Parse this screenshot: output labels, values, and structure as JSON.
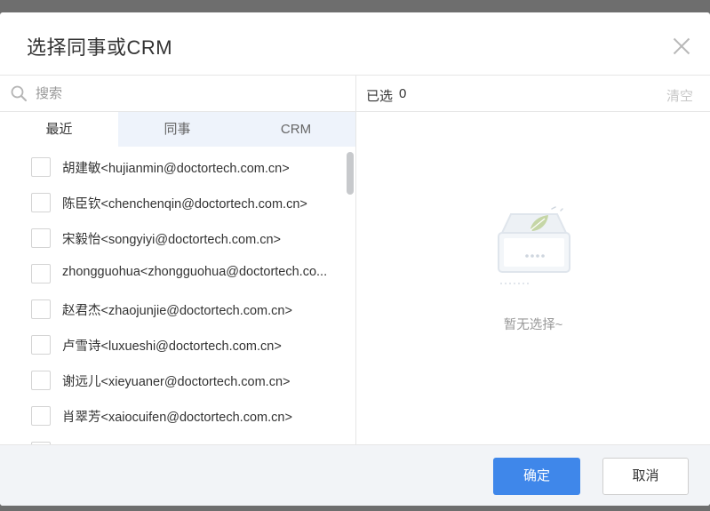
{
  "dialog": {
    "title": "选择同事或CRM",
    "close_icon": "close-icon"
  },
  "search": {
    "placeholder": "搜索",
    "value": "",
    "icon": "search-icon"
  },
  "tabs": [
    {
      "label": "最近",
      "active": true
    },
    {
      "label": "同事",
      "active": false
    },
    {
      "label": "CRM",
      "active": false
    }
  ],
  "contacts": [
    {
      "label": "胡建敏<hujianmin@doctortech.com.cn>",
      "checked": false
    },
    {
      "label": "陈臣钦<chenchenqin@doctortech.com.cn>",
      "checked": false
    },
    {
      "label": "宋毅怡<songyiyi@doctortech.com.cn>",
      "checked": false
    },
    {
      "label": "zhongguohua<zhongguohua@doctortech.co...",
      "checked": false
    },
    {
      "label": "赵君杰<zhaojunjie@doctortech.com.cn>",
      "checked": false
    },
    {
      "label": "卢雪诗<luxueshi@doctortech.com.cn>",
      "checked": false
    },
    {
      "label": "谢远儿<xieyuaner@doctortech.com.cn>",
      "checked": false
    },
    {
      "label": "肖翠芳<xaiocuifen@doctortech.com.cn>",
      "checked": false
    },
    {
      "label": "",
      "checked": false
    }
  ],
  "selected": {
    "label": "已选",
    "count": "0",
    "clear_label": "清空",
    "empty_text": "暂无选择~",
    "empty_icon": "empty-box-icon"
  },
  "footer": {
    "confirm_label": "确定",
    "cancel_label": "取消"
  },
  "colors": {
    "primary": "#3f87ea",
    "tab_bg": "#eef3fb",
    "footer_bg": "#f2f4f7"
  }
}
